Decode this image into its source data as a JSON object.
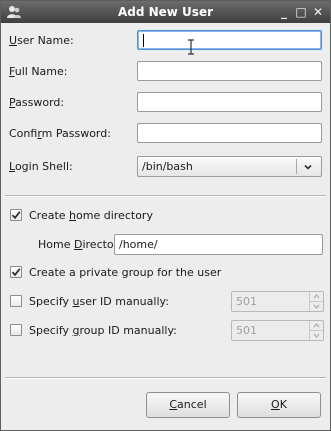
{
  "window": {
    "title": "Add New User",
    "title_buttons": {
      "minimize": "_",
      "maximize": "□",
      "close": "✕"
    }
  },
  "form": {
    "username": {
      "label_mn": "U",
      "label_rest": "ser Name:",
      "value": ""
    },
    "fullname": {
      "label_mn": "F",
      "label_rest": "ull Name:",
      "value": ""
    },
    "password": {
      "label_mn": "P",
      "label_rest": "assword:",
      "value": ""
    },
    "confirm": {
      "label_pre": "Confi",
      "label_mn": "r",
      "label_rest": "m Password:",
      "value": ""
    },
    "shell": {
      "label_mn": "L",
      "label_rest": "ogin Shell:",
      "value": "/bin/bash",
      "icon": "chevron-down-icon"
    }
  },
  "options": {
    "create_home": {
      "label_pre": "Create ",
      "label_mn": "h",
      "label_rest": "ome directory",
      "checked": true
    },
    "home_dir": {
      "label_pre": "Home ",
      "label_mn": "D",
      "label_rest": "irectory:",
      "value": "/home/"
    },
    "private_group": {
      "label": "Create a private group for the user",
      "checked": true
    },
    "uid": {
      "label_pre": "Specify ",
      "label_mn": "u",
      "label_rest": "ser ID manually:",
      "checked": false,
      "value": "501"
    },
    "gid": {
      "label_pre": "Specify ",
      "label_mn": "g",
      "label_rest": "roup ID manually:",
      "checked": false,
      "value": "501"
    }
  },
  "buttons": {
    "cancel": {
      "mn": "C",
      "rest": "ancel"
    },
    "ok": {
      "mn": "O",
      "rest": "K"
    }
  },
  "colors": {
    "titlebar": "#4f4f4f",
    "focus": "#4a90d9",
    "background": "#ededed"
  }
}
